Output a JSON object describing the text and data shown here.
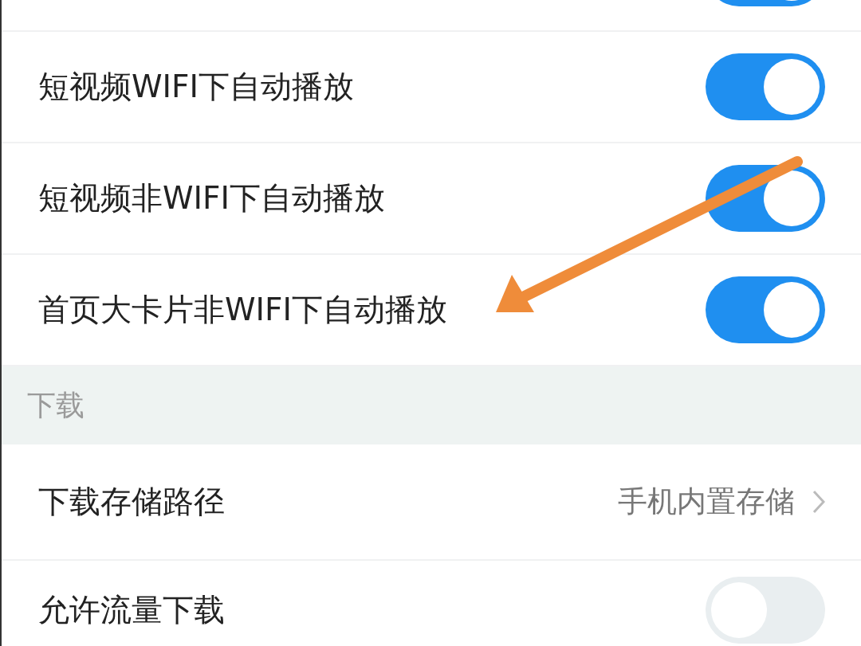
{
  "settings": [
    {
      "kind": "toggle",
      "on": true
    },
    {
      "kind": "toggle",
      "label": "短视频WIFI下自动播放",
      "on": true
    },
    {
      "kind": "toggle",
      "label": "短视频非WIFI下自动播放",
      "on": true
    },
    {
      "kind": "toggle",
      "label": "首页大卡片非WIFI下自动播放",
      "on": true
    },
    {
      "kind": "header",
      "label": "下载"
    },
    {
      "kind": "link",
      "label": "下载存储路径",
      "value": "手机内置存储"
    },
    {
      "kind": "toggle",
      "label": "允许流量下载",
      "on": false
    }
  ]
}
